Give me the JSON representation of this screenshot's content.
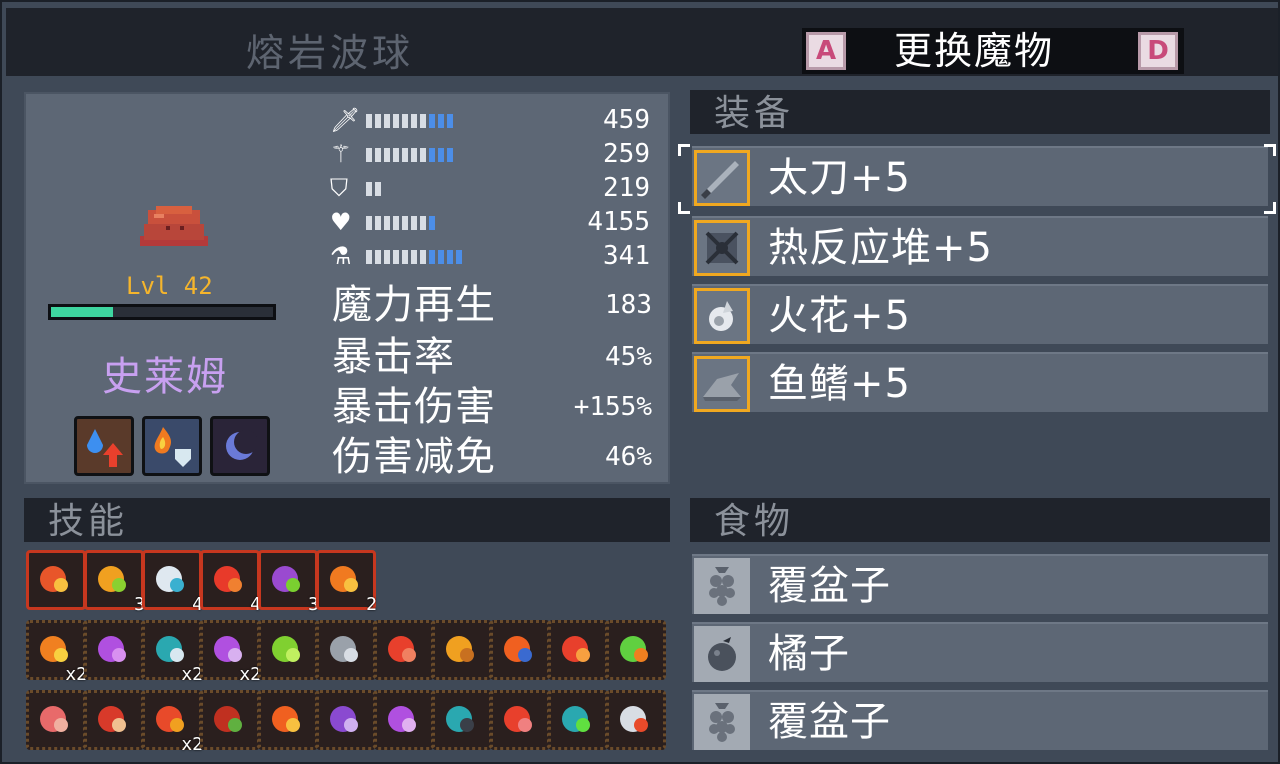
{
  "header": {
    "title": "熔岩波球",
    "swap_label": "更换魔物",
    "key_prev": "A",
    "key_next": "D"
  },
  "monster": {
    "level": "Lvl 42",
    "name": "史莱姆",
    "xp_fraction": 0.28
  },
  "stats": {
    "attack": "459",
    "magic": "259",
    "defense": "219",
    "health": "4155",
    "mana": "341"
  },
  "derived": [
    {
      "label": "魔力再生",
      "value": "183"
    },
    {
      "label": "暴击率",
      "value": "45%"
    },
    {
      "label": "暴击伤害",
      "value": "+155%"
    },
    {
      "label": "伤害减免",
      "value": "46%"
    }
  ],
  "sections": {
    "equipment": "装备",
    "skills": "技能",
    "food": "食物"
  },
  "equipment": [
    {
      "label": "太刀+5",
      "icon": "katana-icon"
    },
    {
      "label": "热反应堆+5",
      "icon": "reactor-icon"
    },
    {
      "label": "火花+5",
      "icon": "spark-icon"
    },
    {
      "label": "鱼鳍+5",
      "icon": "fin-icon"
    }
  ],
  "food": [
    {
      "label": "覆盆子",
      "icon": "raspberry-icon"
    },
    {
      "label": "橘子",
      "icon": "orange-icon"
    },
    {
      "label": "覆盆子",
      "icon": "raspberry-icon"
    }
  ],
  "skills_top": [
    {
      "icon": "lava-shield-icon",
      "count": ""
    },
    {
      "icon": "fire-heart-icon",
      "count": "3"
    },
    {
      "icon": "wave-icon",
      "count": "4"
    },
    {
      "icon": "fire-drops-icon",
      "count": "4"
    },
    {
      "icon": "poison-flask-icon",
      "count": "3"
    },
    {
      "icon": "fire-claw-icon",
      "count": "2"
    }
  ],
  "skills_mid": [
    {
      "icon": "fire-spark-icon",
      "count": "x2"
    },
    {
      "icon": "heart-icon",
      "count": ""
    },
    {
      "icon": "shield-orb-icon",
      "count": "x2"
    },
    {
      "icon": "mana-flask-icon",
      "count": "x2"
    },
    {
      "icon": "green-staff-icon",
      "count": ""
    },
    {
      "icon": "sword-skull-icon",
      "count": ""
    },
    {
      "icon": "strength-icon",
      "count": ""
    },
    {
      "icon": "crosshair-icon",
      "count": ""
    },
    {
      "icon": "flame-sword-icon",
      "count": ""
    },
    {
      "icon": "fire-figure-icon",
      "count": ""
    },
    {
      "icon": "green-flame-icon",
      "count": ""
    }
  ],
  "skills_bot": [
    {
      "icon": "claw-icon",
      "count": ""
    },
    {
      "icon": "redhead-icon",
      "count": ""
    },
    {
      "icon": "target-icon",
      "count": "x2"
    },
    {
      "icon": "potion-icon",
      "count": ""
    },
    {
      "icon": "double-fire-icon",
      "count": ""
    },
    {
      "icon": "rune-icon",
      "count": ""
    },
    {
      "icon": "mana-up-icon",
      "count": ""
    },
    {
      "icon": "hammer-icon",
      "count": ""
    },
    {
      "icon": "red-gem-icon",
      "count": ""
    },
    {
      "icon": "ring-icon",
      "count": ""
    },
    {
      "icon": "shield-icon",
      "count": ""
    }
  ],
  "colors": {
    "accent_gold": "#f0a820",
    "panel": "#5d6775",
    "name_purple": "#c8a0f0",
    "level_gold": "#f5b52c",
    "xp_green": "#3ed6a0"
  }
}
